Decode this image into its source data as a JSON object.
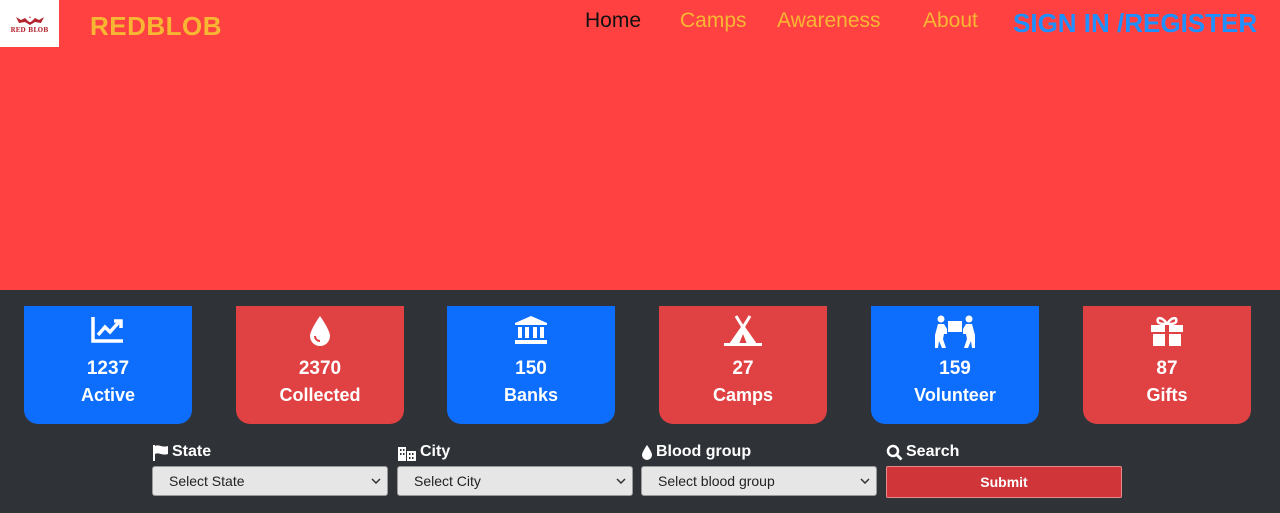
{
  "nav": {
    "logo_text": "RED BLOB",
    "brand": "REDBLOB",
    "links": [
      {
        "label": "Home"
      },
      {
        "label": "Camps"
      },
      {
        "label": "Awareness"
      },
      {
        "label": "About"
      }
    ],
    "signin": "SIGN IN /REGISTER"
  },
  "stats": [
    {
      "value": "1237",
      "label": "Active",
      "icon": "chart-line-icon",
      "color": "#0d6efd"
    },
    {
      "value": "2370",
      "label": "Collected",
      "icon": "blood-drop-icon",
      "color": "#e04243"
    },
    {
      "value": "150",
      "label": "Banks",
      "icon": "bank-icon",
      "color": "#0d6efd"
    },
    {
      "value": "27",
      "label": "Camps",
      "icon": "tent-icon",
      "color": "#e04243"
    },
    {
      "value": "159",
      "label": "Volunteer",
      "icon": "people-carry-icon",
      "color": "#0d6efd"
    },
    {
      "value": "87",
      "label": "Gifts",
      "icon": "gift-icon",
      "color": "#e04243"
    }
  ],
  "filters": {
    "state": {
      "label": "State",
      "selected": "Select State"
    },
    "city": {
      "label": "City",
      "selected": "Select City"
    },
    "blood_group": {
      "label": "Blood group",
      "selected": "Select blood group"
    },
    "search": {
      "label": "Search",
      "button": "Submit"
    }
  },
  "colors": {
    "hero_bg": "#ff4141",
    "dark_bg": "#2f3237",
    "brand": "#f7b733",
    "signin": "#1e90ff"
  }
}
